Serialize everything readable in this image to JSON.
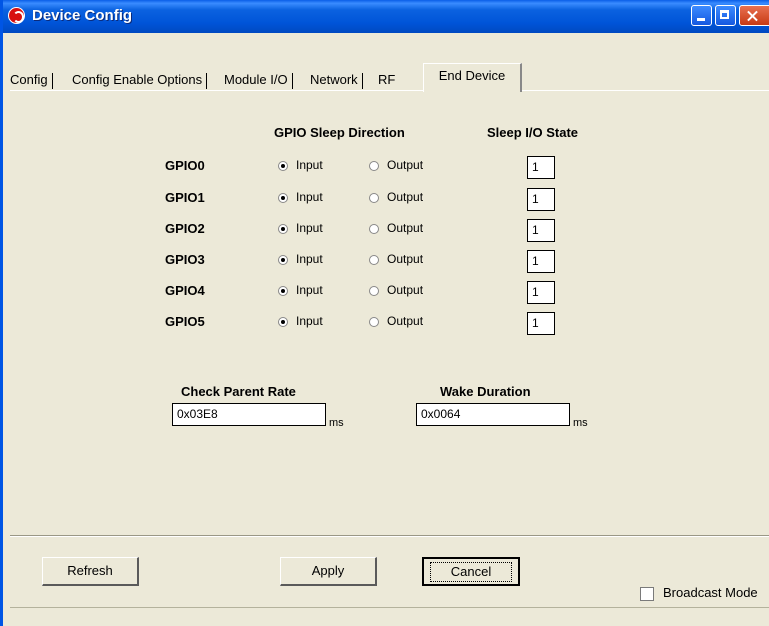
{
  "window": {
    "title": "Device Config"
  },
  "tabs": [
    {
      "label": "Config"
    },
    {
      "label": "Config Enable Options"
    },
    {
      "label": "Module I/O"
    },
    {
      "label": "Network"
    },
    {
      "label": "RF"
    },
    {
      "label": "End Device",
      "active": true
    }
  ],
  "gpio": {
    "direction_header": "GPIO Sleep Direction",
    "state_header": "Sleep I/O State",
    "input_label": "Input",
    "output_label": "Output",
    "rows": [
      {
        "name": "GPIO0",
        "direction": "Input",
        "state": "1"
      },
      {
        "name": "GPIO1",
        "direction": "Input",
        "state": "1"
      },
      {
        "name": "GPIO2",
        "direction": "Input",
        "state": "1"
      },
      {
        "name": "GPIO3",
        "direction": "Input",
        "state": "1"
      },
      {
        "name": "GPIO4",
        "direction": "Input",
        "state": "1"
      },
      {
        "name": "GPIO5",
        "direction": "Input",
        "state": "1"
      }
    ]
  },
  "check_parent_rate": {
    "label": "Check Parent Rate",
    "value": "0x03E8",
    "unit": "ms"
  },
  "wake_duration": {
    "label": "Wake Duration",
    "value": "0x0064",
    "unit": "ms"
  },
  "buttons": {
    "refresh": "Refresh",
    "apply": "Apply",
    "cancel": "Cancel"
  },
  "broadcast": {
    "label": "Broadcast Mode",
    "checked": false
  },
  "icons": [
    "app-logo-icon",
    "minimize-icon",
    "maximize-icon",
    "close-icon"
  ],
  "colors": {
    "titlebar": "#0054d8",
    "dialog_bg": "#ece9d8"
  }
}
